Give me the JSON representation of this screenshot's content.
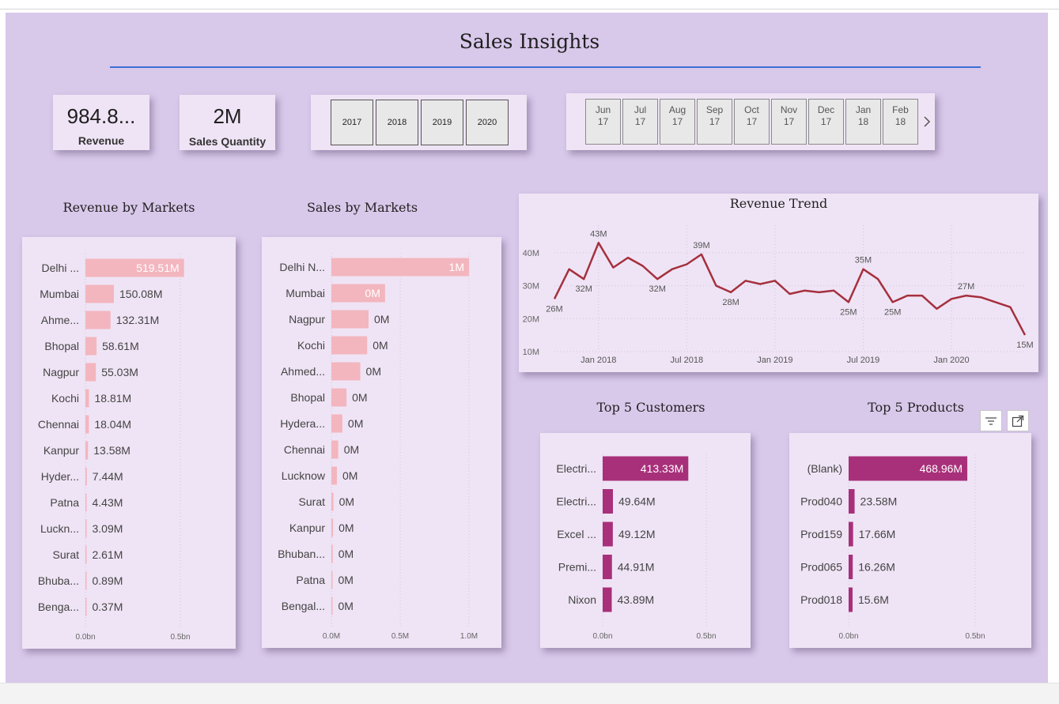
{
  "page": {
    "title": "Sales Insights"
  },
  "kpis": {
    "revenue": {
      "value": "984.8...",
      "label": "Revenue"
    },
    "quantity": {
      "value": "2M",
      "label": "Sales Quantity"
    }
  },
  "year_slicer": [
    "2017",
    "2018",
    "2019",
    "2020"
  ],
  "month_slicer": [
    {
      "m": "Jun",
      "y": "17"
    },
    {
      "m": "Jul",
      "y": "17"
    },
    {
      "m": "Aug",
      "y": "17"
    },
    {
      "m": "Sep",
      "y": "17"
    },
    {
      "m": "Oct",
      "y": "17"
    },
    {
      "m": "Nov",
      "y": "17"
    },
    {
      "m": "Dec",
      "y": "17"
    },
    {
      "m": "Jan",
      "y": "18"
    },
    {
      "m": "Feb",
      "y": "18"
    }
  ],
  "sections": {
    "revenue_markets": "Revenue by Markets",
    "sales_markets": "Sales by Markets",
    "revenue_trend": "Revenue Trend",
    "top_customers": "Top 5 Customers",
    "top_products": "Top 5 Products"
  },
  "colors": {
    "pink_bar": "#f3b6be",
    "magenta_bar": "#a8307a",
    "trend_line": "#a5303e",
    "canvas": "#d8c8ea",
    "card": "#efe4f5"
  },
  "icons": [
    "filter-icon",
    "focus-mode-icon",
    "chevron-right-icon"
  ],
  "chart_data": [
    {
      "id": "revenue_by_markets",
      "type": "bar",
      "orientation": "horizontal",
      "categories": [
        "Delhi ...",
        "Mumbai",
        "Ahme...",
        "Bhopal",
        "Nagpur",
        "Kochi",
        "Chennai",
        "Kanpur",
        "Hyder...",
        "Patna",
        "Luckn...",
        "Surat",
        "Bhuba...",
        "Benga..."
      ],
      "values": [
        519.51,
        150.08,
        132.31,
        58.61,
        55.03,
        18.81,
        18.04,
        13.58,
        7.44,
        4.43,
        3.09,
        2.61,
        0.89,
        0.37
      ],
      "labels": [
        "519.51M",
        "150.08M",
        "132.31M",
        "58.61M",
        "55.03M",
        "18.81M",
        "18.04M",
        "13.58M",
        "7.44M",
        "4.43M",
        "3.09M",
        "2.61M",
        "0.89M",
        "0.37M"
      ],
      "xlim": [
        0,
        500
      ],
      "xticks": [
        "0.0bn",
        "0.5bn"
      ]
    },
    {
      "id": "sales_by_markets",
      "type": "bar",
      "orientation": "horizontal",
      "categories": [
        "Delhi N...",
        "Mumbai",
        "Nagpur",
        "Kochi",
        "Ahmed...",
        "Bhopal",
        "Hydera...",
        "Chennai",
        "Lucknow",
        "Surat",
        "Kanpur",
        "Bhuban...",
        "Patna",
        "Bengal..."
      ],
      "values": [
        1.0,
        0.39,
        0.27,
        0.26,
        0.21,
        0.11,
        0.08,
        0.05,
        0.04,
        0.015,
        0.012,
        0.01,
        0.008,
        0.005
      ],
      "labels": [
        "1M",
        "0M",
        "0M",
        "0M",
        "0M",
        "0M",
        "0M",
        "0M",
        "0M",
        "0M",
        "0M",
        "0M",
        "0M",
        "0M"
      ],
      "xlim": [
        0,
        1.0
      ],
      "xticks": [
        "0.0M",
        "0.5M",
        "1.0M"
      ]
    },
    {
      "id": "revenue_trend",
      "type": "line",
      "x": [
        "2017-10",
        "2017-11",
        "2017-12",
        "2018-01",
        "2018-02",
        "2018-03",
        "2018-04",
        "2018-05",
        "2018-06",
        "2018-07",
        "2018-08",
        "2018-09",
        "2018-10",
        "2018-11",
        "2018-12",
        "2019-01",
        "2019-02",
        "2019-03",
        "2019-04",
        "2019-05",
        "2019-06",
        "2019-07",
        "2019-08",
        "2019-09",
        "2019-10",
        "2019-11",
        "2019-12",
        "2020-01",
        "2020-02",
        "2020-03",
        "2020-04",
        "2020-05",
        "2020-06"
      ],
      "values": [
        26,
        35,
        32,
        43,
        35.5,
        38.5,
        36,
        32,
        35,
        36.5,
        39.5,
        30,
        28,
        31.5,
        30.5,
        31.5,
        27.5,
        28.5,
        28,
        28.5,
        25,
        35,
        32,
        25,
        27,
        27,
        23,
        26,
        27,
        26.5,
        25,
        23.5,
        15
      ],
      "point_labels": {
        "0": "26M",
        "2": "32M",
        "3": "43M",
        "7": "32M",
        "10": "39M",
        "12": "28M",
        "20": "25M",
        "21": "35M",
        "23": "25M",
        "28": "27M",
        "32": "15M"
      },
      "ylim": [
        10,
        45
      ],
      "yticks": [
        "10M",
        "20M",
        "30M",
        "40M"
      ],
      "xticks": [
        "Jan 2018",
        "Jul 2018",
        "Jan 2019",
        "Jul 2019",
        "Jan 2020"
      ]
    },
    {
      "id": "top_customers",
      "type": "bar",
      "orientation": "horizontal",
      "categories": [
        "Electri...",
        "Electri...",
        "Excel ...",
        "Premi...",
        "Nixon"
      ],
      "values": [
        413.33,
        49.64,
        49.12,
        44.91,
        43.89
      ],
      "labels": [
        "413.33M",
        "49.64M",
        "49.12M",
        "44.91M",
        "43.89M"
      ],
      "xlim": [
        0,
        500
      ],
      "xticks": [
        "0.0bn",
        "0.5bn"
      ]
    },
    {
      "id": "top_products",
      "type": "bar",
      "orientation": "horizontal",
      "categories": [
        "(Blank)",
        "Prod040",
        "Prod159",
        "Prod065",
        "Prod018"
      ],
      "values": [
        468.96,
        23.58,
        17.66,
        16.26,
        15.6
      ],
      "labels": [
        "468.96M",
        "23.58M",
        "17.66M",
        "16.26M",
        "15.6M"
      ],
      "xlim": [
        0,
        500
      ],
      "xticks": [
        "0.0bn",
        "0.5bn"
      ]
    }
  ]
}
